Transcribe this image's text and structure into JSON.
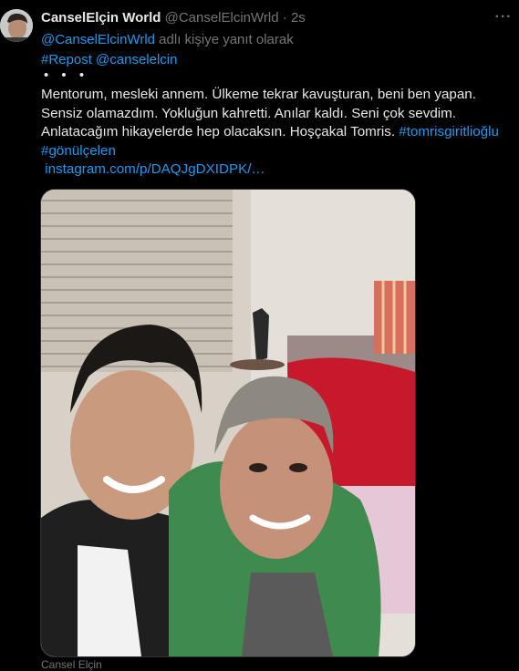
{
  "tweet": {
    "display_name": "CanselElçin World",
    "handle": "@CanselElcinWrld",
    "separator": "·",
    "time": "2s",
    "more_icon": "more-horizontal-icon",
    "reply_to_handle": "@CanselElcinWrld",
    "reply_to_suffix": "adlı kişiye yanıt olarak",
    "repost_tag": "#Repost",
    "repost_mention": "@canselelcin",
    "dots": "• • •",
    "lines": [
      "Mentorum, mesleki annem. Ülkeme tekrar kavuşturan, beni ben yapan.",
      "Sensiz olamazdım.  Yokluğun kahretti. Anılar kaldı. Seni çok sevdim.",
      "Anlatacağım hikayelerde hep olacaksın. Hoşçakal Tomris."
    ],
    "hashtag_1": "#tomrisgiritlioğlu",
    "hashtag_2": "#gönülçelen",
    "link": "instagram.com/p/DAQJgDXIDPK/…",
    "media_caption": "Cansel Elçin"
  },
  "colors": {
    "background": "#000000",
    "text": "#e7e9ea",
    "muted": "#71767b",
    "accent": "#1d9bf0",
    "border": "#2f3336"
  }
}
